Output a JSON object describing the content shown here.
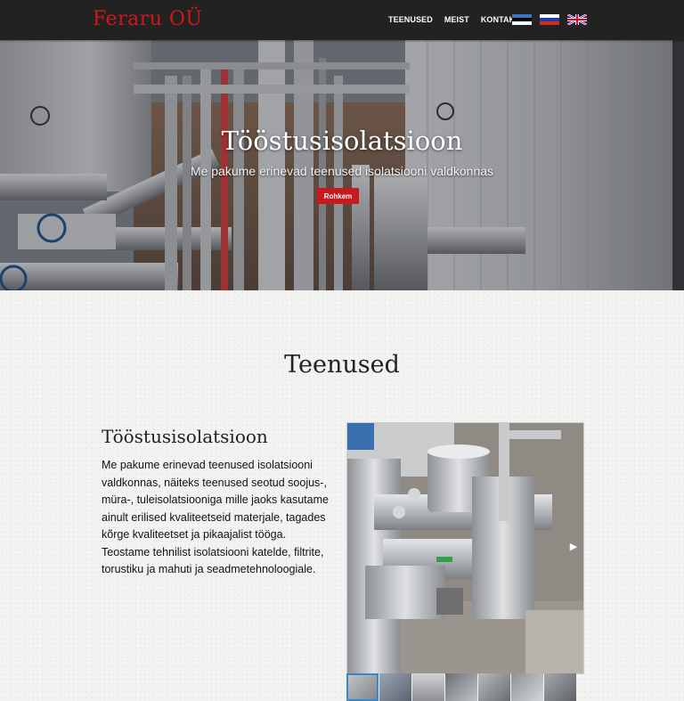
{
  "nav": {
    "brand": "Feraru OÜ",
    "links": [
      "TEENUSED",
      "MEIST",
      "KONTAKT"
    ],
    "flags": [
      "estonian-flag-icon",
      "russian-flag-icon",
      "english-flag-icon"
    ]
  },
  "hero": {
    "title": "Tööstusisolatsioon",
    "subtitle": "Me pakume erinevad teenused isolatsiooni valdkonnas",
    "button": "Rohkem"
  },
  "services": {
    "heading": "Teenused",
    "item_title": "Tööstusisolatsioon",
    "paragraph1": "Me pakume erinevad teenused isolatsiooni valdkonnas, näiteks teenused seotud soojus-, müra-, tuleisolatsiooniga mille jaoks kasutame ainult erilised kvaliteetseid materjale, tagades kõrge kvaliteetset ja pikaajalist tööga.",
    "paragraph2": "Teostame tehnilist isolatsiooni katelde, filtrite, torustiku ja mahuti ja seadmetehnoloogiale."
  },
  "gallery": {
    "next_icon": "play-arrow-icon",
    "thumbnail_count": 7
  },
  "colors": {
    "navbar": "#222222",
    "brand": "#d0181b",
    "button": "#c9191e",
    "thumb_active": "#3a87c8"
  }
}
